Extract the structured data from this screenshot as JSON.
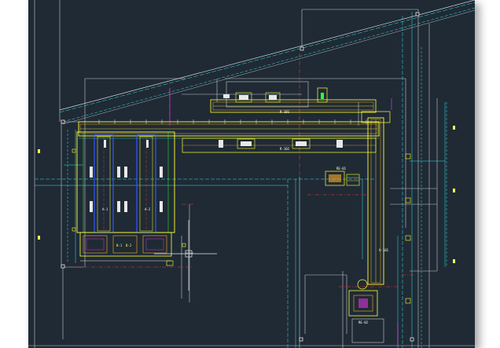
{
  "drawing": {
    "background": "#1f2a35",
    "colors": {
      "yellow": "#ffff33",
      "cyan": "#33e5e5",
      "white": "#e8e8e8",
      "red": "#ff3333",
      "blue": "#3355ff",
      "green": "#33ff33",
      "magenta": "#ff33ff",
      "orange": "#ffaa22"
    },
    "labels": {
      "top_conveyor": "R-101",
      "lower_conveyor": "R-102",
      "equipment_tag": "RE-01",
      "lane_1": "A-1",
      "lane_2": "A-2",
      "base_left": "B-1",
      "base_right": "B-2",
      "vertical_tag": "V-101",
      "bottom_tag": "RE-02"
    },
    "icons": {
      "crosshair": "crosshair-cursor-icon"
    }
  }
}
